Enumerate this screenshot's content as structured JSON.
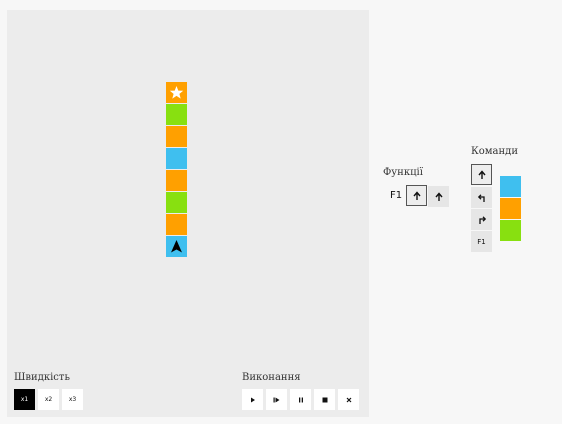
{
  "colors": {
    "orange": "#ffa000",
    "green": "#88e010",
    "blue": "#3fbfef",
    "board": "#ececec",
    "background": "#f7f7f7"
  },
  "board": {
    "path_tiles": [
      "orange-star",
      "green",
      "orange",
      "blue",
      "orange",
      "green",
      "orange",
      "blue-robot"
    ],
    "robot_direction": "up",
    "star_icon": "star-icon",
    "robot_icon": "arrow-up-robot-icon"
  },
  "speed": {
    "label": "Швидкість",
    "options": [
      "x1",
      "x2",
      "x3"
    ],
    "selected": "x1"
  },
  "execution": {
    "label": "Виконання",
    "controls": [
      "play-icon",
      "step-icon",
      "pause-icon",
      "stop-icon",
      "reset-icon"
    ]
  },
  "functions": {
    "label": "Функції",
    "f1_label": "F1",
    "slots": [
      "arrow-up-icon",
      "arrow-up-icon"
    ]
  },
  "commands": {
    "label": "Команди",
    "items": [
      "arrow-up-icon",
      "turn-left-icon",
      "turn-right-icon",
      "F1"
    ],
    "f1_text": "F1",
    "color_swatches": [
      "blue",
      "orange",
      "green"
    ]
  }
}
